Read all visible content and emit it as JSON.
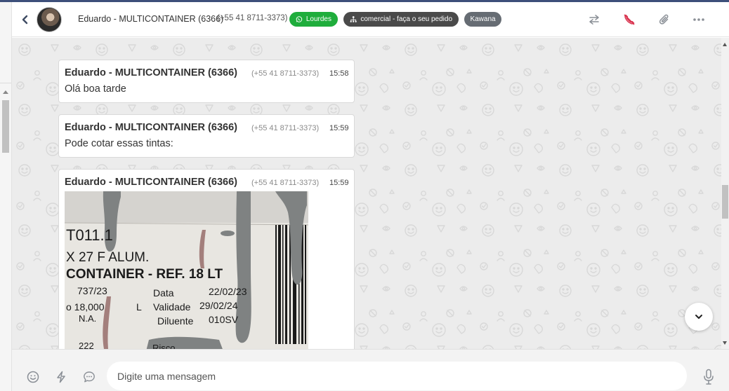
{
  "header": {
    "contact_name": "Eduardo - MULTICONTAINER (6366)",
    "contact_phone": "(+55 41 8711-3373)",
    "tags": [
      {
        "label": "Lourdes",
        "color": "#1fad3c",
        "icon": "whatsapp-icon"
      },
      {
        "label": "comercial - faça o seu pedido",
        "color": "#4a4a4a",
        "icon": "org-chart-icon"
      },
      {
        "label": "Kawana",
        "color": "#666c73"
      }
    ],
    "actions": [
      "transfer-icon",
      "end-call-icon",
      "paperclip-icon",
      "more-icon"
    ],
    "accent_red": "#d9344f"
  },
  "messages": [
    {
      "sender": "Eduardo - MULTICONTAINER (6366)",
      "phone": "(+55 41 8711-3373)",
      "time": "15:58",
      "text": "Olá boa tarde"
    },
    {
      "sender": "Eduardo - MULTICONTAINER (6366)",
      "phone": "(+55 41 8711-3373)",
      "time": "15:59",
      "text": "Pode cotar essas tintas:"
    },
    {
      "sender": "Eduardo - MULTICONTAINER (6366)",
      "phone": "(+55 41 8711-3373)",
      "time": "15:59",
      "image": {
        "lines": [
          "T011.1",
          "X 27 F ALUM.",
          "CONTAINER - REF. 18 LT",
          "737/23",
          "Data",
          "22/02/23",
          "o 18,000",
          "L",
          "Validade",
          "29/02/24",
          "N.A.",
          "Diluente",
          "010SV",
          "222",
          "Risco"
        ]
      }
    }
  ],
  "composer": {
    "placeholder": "Digite uma mensagem",
    "buttons": [
      "emoji-icon",
      "lightning-icon",
      "quick-reply-icon",
      "microphone-icon"
    ]
  }
}
